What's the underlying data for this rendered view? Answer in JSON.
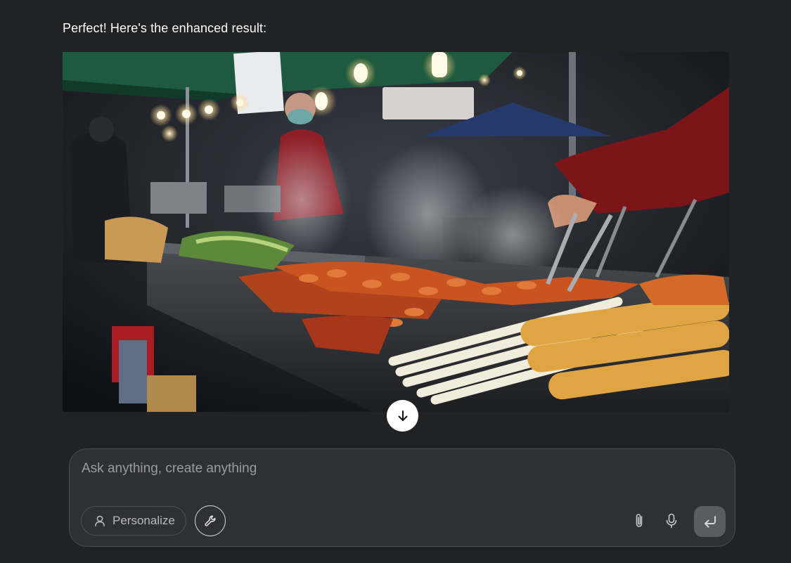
{
  "chat": {
    "message": "Perfect! Here's the enhanced result:"
  },
  "image": {
    "subject": "night street food market stall with steaming trays of spicy rice cakes and fish cakes"
  },
  "composer": {
    "placeholder": "Ask anything, create anything",
    "personalize_label": "Personalize"
  },
  "icons": {
    "scroll": "arrow-down-icon",
    "personalize": "user-icon",
    "tools": "wrench-icon",
    "attach": "paperclip-icon",
    "voice": "microphone-icon",
    "send": "enter-icon"
  }
}
